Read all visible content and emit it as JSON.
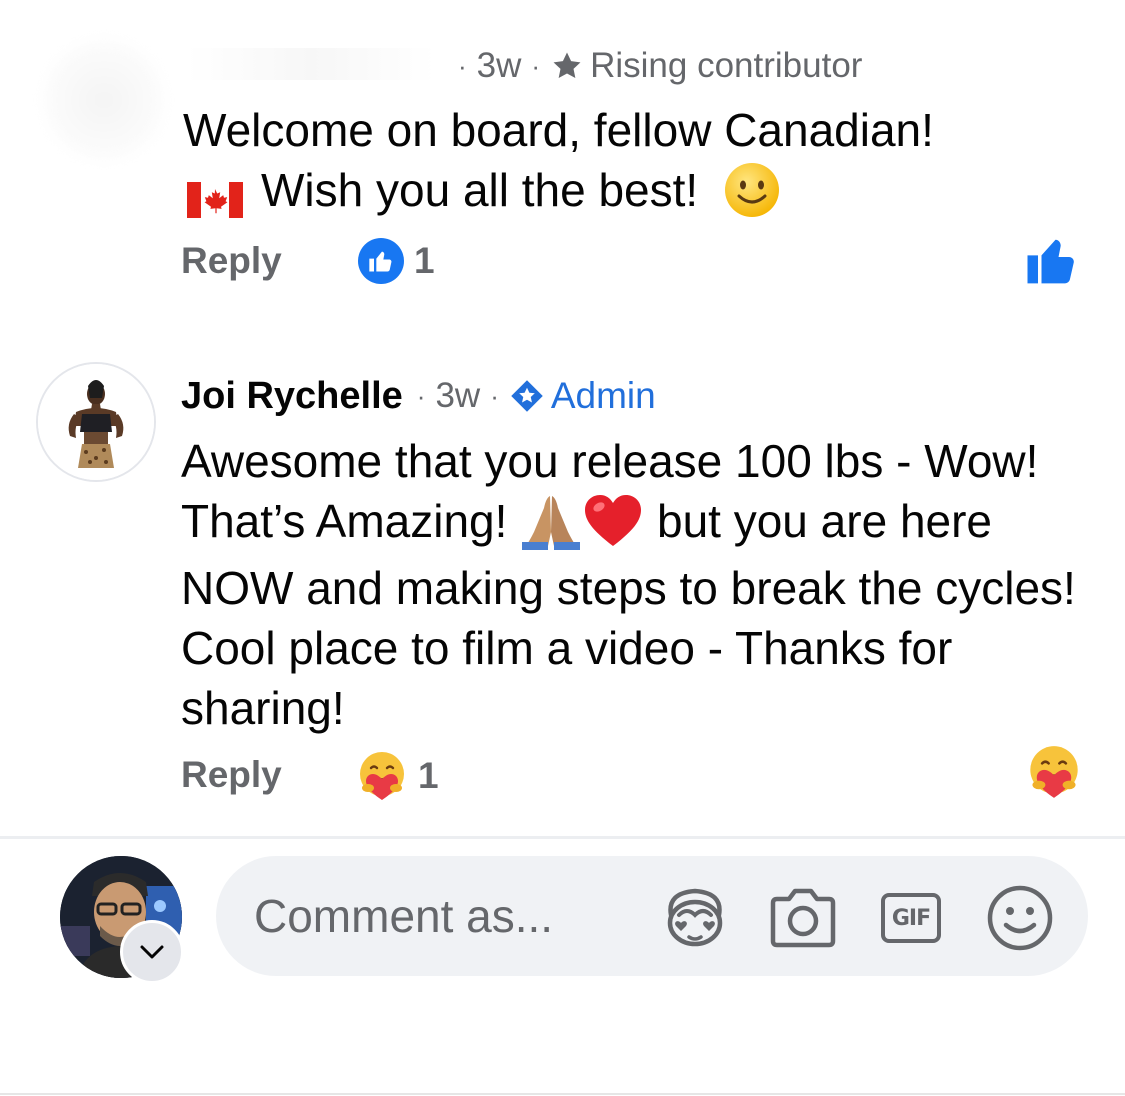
{
  "colors": {
    "facebook_blue": "#1877f2",
    "admin_blue": "#216fdb",
    "secondary_text": "#65676b",
    "composer_bg": "#f0f2f5"
  },
  "comments": [
    {
      "age": "3w",
      "badge_icon": "star-icon",
      "badge": "Rising contributor",
      "text_line1": "Welcome on board, fellow Canadian!",
      "text_line2": "Wish you all the best!",
      "emoji": [
        "canada-flag-emoji",
        "smiling-face-emoji"
      ],
      "reply_label": "Reply",
      "reaction_icon": "like-icon",
      "reaction_count": "1"
    },
    {
      "author": "Joi Rychelle",
      "age": "3w",
      "badge_icon": "admin-icon",
      "badge": "Admin",
      "text_part1": "Awesome that you release 100 lbs - Wow! That’s Amazing!",
      "text_part2": "but you are here NOW and making steps to break the cycles! Cool place to film a video - Thanks for sharing!",
      "emoji": [
        "folded-hands-emoji",
        "red-heart-emoji"
      ],
      "reply_label": "Reply",
      "reaction_icon": "care-icon",
      "reaction_count": "1"
    }
  ],
  "composer": {
    "placeholder": "Comment as...",
    "tools": [
      "avatar-sticker-icon",
      "camera-icon",
      "gif-icon",
      "emoji-icon"
    ],
    "gif_label": "GIF"
  }
}
